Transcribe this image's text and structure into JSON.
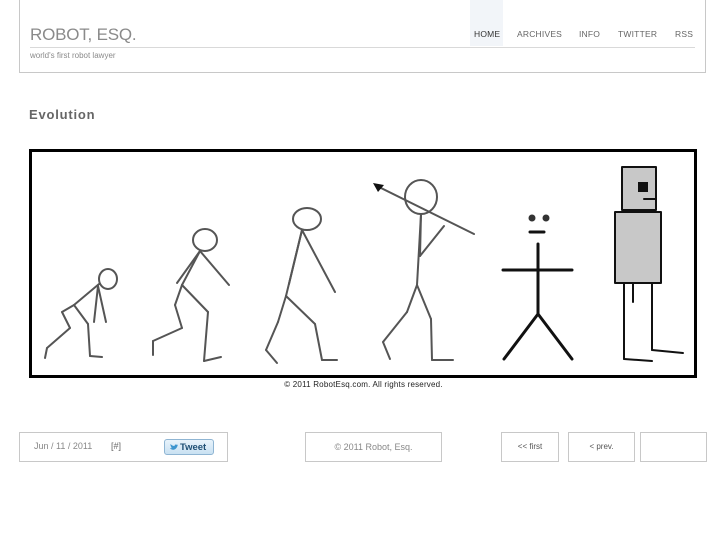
{
  "site": {
    "title": "ROBOT, ESQ.",
    "tagline": "world's first robot lawyer"
  },
  "nav": {
    "items": [
      "HOME",
      "ARCHIVES",
      "INFO",
      "TWITTER",
      "RSS"
    ],
    "active": "HOME"
  },
  "post": {
    "title": "Evolution",
    "caption": "© 2011 RobotEsq.com.  All rights reserved."
  },
  "footer": {
    "date": "Jun / 11 / 2011",
    "permalink": "[#]",
    "tweet_label": "Tweet",
    "copyright": "© 2011 Robot, Esq.",
    "first_label": "<< first",
    "prev_label": "< prev."
  },
  "colors": {
    "header_border": "#c8c8c8",
    "nav_active_bg": "#f2f5f9",
    "figure_stroke": "#555555",
    "robot_fill": "#c8c8c8"
  }
}
